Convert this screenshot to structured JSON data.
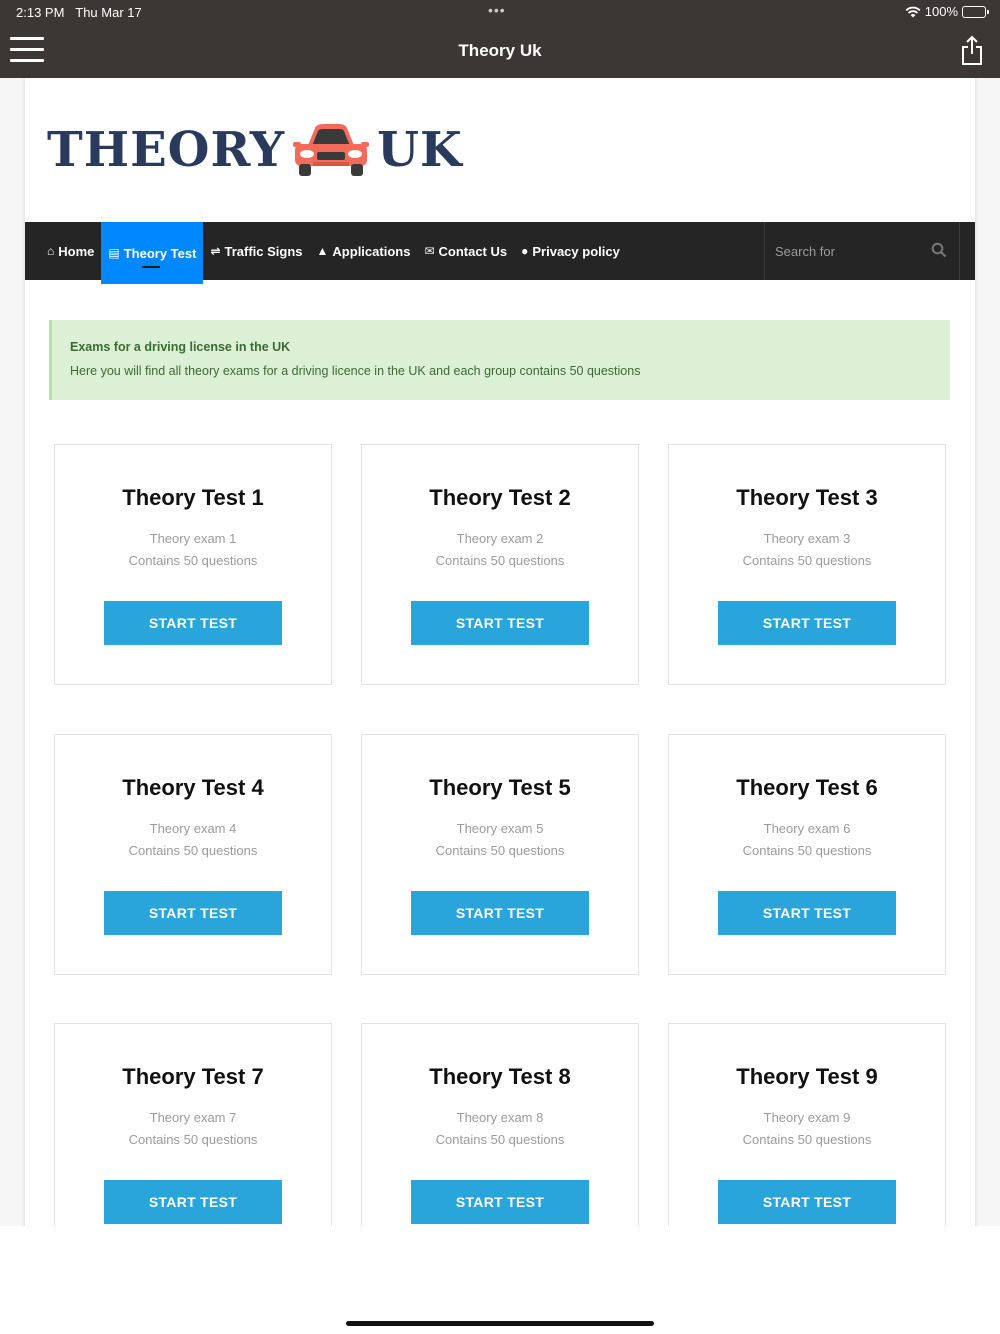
{
  "status_bar": {
    "time": "2:13 PM",
    "date": "Thu Mar 17",
    "battery": "100%"
  },
  "app_bar": {
    "title": "Theory Uk"
  },
  "logo": {
    "left_text": "THEORY",
    "right_text": "UK"
  },
  "nav": {
    "items": [
      {
        "label": "Home",
        "icon": "home-icon",
        "glyph": "⌂"
      },
      {
        "label": "Theory Test",
        "icon": "copy-icon",
        "glyph": "▤"
      },
      {
        "label": "Traffic Signs",
        "icon": "signs-icon",
        "glyph": "⇌"
      },
      {
        "label": "Applications",
        "icon": "car-icon",
        "glyph": "▲"
      },
      {
        "label": "Contact Us",
        "icon": "envelope-icon",
        "glyph": "✉"
      },
      {
        "label": "Privacy policy",
        "icon": "info-icon",
        "glyph": "●"
      }
    ],
    "active_index": 1,
    "search_placeholder": "Search for"
  },
  "alert": {
    "title": "Exams for a driving license in the UK",
    "text": "Here you will find all theory exams for a driving licence in the UK and each group contains 50 questions"
  },
  "cards": [
    {
      "title": "Theory Test 1",
      "exam": "Theory exam 1",
      "count": "Contains 50 questions",
      "button": "START TEST"
    },
    {
      "title": "Theory Test 2",
      "exam": "Theory exam 2",
      "count": "Contains 50 questions",
      "button": "START TEST"
    },
    {
      "title": "Theory Test 3",
      "exam": "Theory exam 3",
      "count": "Contains 50 questions",
      "button": "START TEST"
    },
    {
      "title": "Theory Test 4",
      "exam": "Theory exam 4",
      "count": "Contains 50 questions",
      "button": "START TEST"
    },
    {
      "title": "Theory Test 5",
      "exam": "Theory exam 5",
      "count": "Contains 50 questions",
      "button": "START TEST"
    },
    {
      "title": "Theory Test 6",
      "exam": "Theory exam 6",
      "count": "Contains 50 questions",
      "button": "START TEST"
    },
    {
      "title": "Theory Test 7",
      "exam": "Theory exam 7",
      "count": "Contains 50 questions",
      "button": "START TEST"
    },
    {
      "title": "Theory Test 8",
      "exam": "Theory exam 8",
      "count": "Contains 50 questions",
      "button": "START TEST"
    },
    {
      "title": "Theory Test 9",
      "exam": "Theory exam 9",
      "count": "Contains 50 questions",
      "button": "START TEST"
    }
  ],
  "colors": {
    "nav_bg": "#252525",
    "active": "#0088ff",
    "button": "#29a5dc",
    "alert_bg": "#dcf0d6",
    "alert_text": "#3b6b32",
    "logo": "#2a3a5c",
    "car": "#f26b5b"
  }
}
